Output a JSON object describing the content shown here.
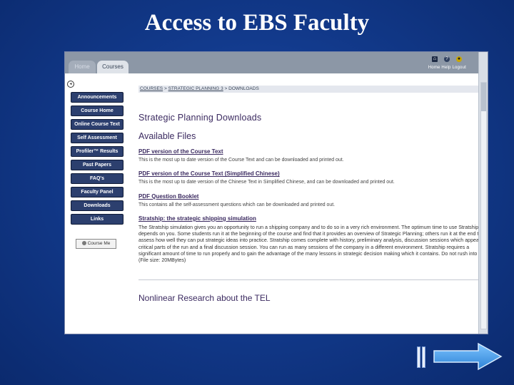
{
  "slide_title": "Access to EBS Faculty",
  "browser": {
    "tabs": [
      {
        "label": "Home"
      },
      {
        "label": "Courses"
      }
    ],
    "top_links": "Home  Help  Logout"
  },
  "sidebar": {
    "items": [
      {
        "label": "Announcements"
      },
      {
        "label": "Course Home"
      },
      {
        "label": "Online Course Text"
      },
      {
        "label": "Self Assessment"
      },
      {
        "label": "Profiler™ Results"
      },
      {
        "label": "Past Papers"
      },
      {
        "label": "FAQ's"
      },
      {
        "label": "Faculty Panel"
      },
      {
        "label": "Downloads"
      },
      {
        "label": "Links"
      }
    ],
    "badge": "Course Me"
  },
  "breadcrumb": {
    "item1": "COURSES",
    "sep1": " > ",
    "item2": "STRATEGIC PLANNING 3",
    "sep2": " > ",
    "item3": "DOWNLOADS"
  },
  "main": {
    "title": "Strategic Planning Downloads",
    "subtitle": "Available Files",
    "files": [
      {
        "link": "PDF version of the Course Text",
        "desc": "This is the most up to date version of the Course Text and can be downloaded and printed out."
      },
      {
        "link": "PDF version of the Course Text (Simplified Chinese)",
        "desc": "This is the most up to date version of the Chinese Text in Simplified Chinese, and can be downloaded and printed out."
      },
      {
        "link": "PDF Question Booklet",
        "desc": "This contains all the self-assessment questions which can be downloaded and printed out."
      },
      {
        "link": "Stratship: the strategic shipping simulation",
        "desc": "The Stratship simulation gives you an opportunity to run a shipping company and to do so in a very rich environment. The optimum time to use Stratship depends on you. Some students run it at the beginning of the course and find that it provides an overview of Strategic Planning; others run it at the end to assess how well they can put strategic ideas into practice. Stratship comes complete with history, preliminary analysis, discussion sessions which appear at critical parts of the run and a final discussion session. You can run as many sessions of the company in a different environment. Stratship requires a significant amount of time to run properly and to gain the advantage of the many lessons in strategic decision making which it contains. Do not rush into it. (File size: 20MBytes)"
      }
    ],
    "cut_title": "Nonlinear Research about the TEL"
  }
}
